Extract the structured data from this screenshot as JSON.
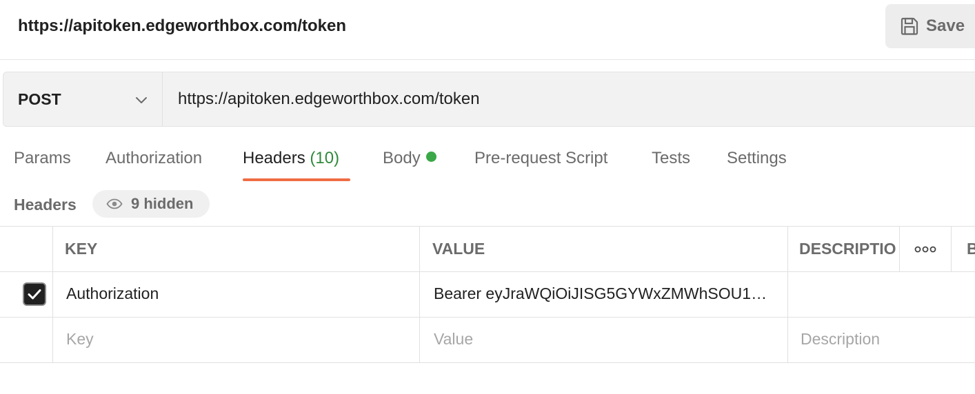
{
  "header": {
    "request_name": "https://apitoken.edgeworthbox.com/token",
    "save_label": "Save"
  },
  "request": {
    "method": "POST",
    "url": "https://apitoken.edgeworthbox.com/token"
  },
  "tabs": [
    {
      "label": "Params"
    },
    {
      "label": "Authorization"
    },
    {
      "label": "Headers",
      "count": "(10)",
      "active": true
    },
    {
      "label": "Body",
      "indicator": "green-dot"
    },
    {
      "label": "Pre-request Script"
    },
    {
      "label": "Tests"
    },
    {
      "label": "Settings"
    }
  ],
  "headers_section": {
    "title": "Headers",
    "hidden_label": "9 hidden",
    "hidden_icon": "eye-icon"
  },
  "table": {
    "columns": [
      "KEY",
      "VALUE",
      "DESCRIPTIO",
      "B"
    ],
    "rows": [
      {
        "checked": true,
        "key": "Authorization",
        "value": "Bearer eyJraWQiOiJISG5GYWxZMWhSOU1…",
        "description": ""
      }
    ],
    "placeholders": {
      "key": "Key",
      "value": "Value",
      "description": "Description"
    }
  },
  "colors": {
    "active_tab_underline": "#ef6c45",
    "count_green": "#2f8a3a",
    "body_dot": "#3aa847"
  }
}
